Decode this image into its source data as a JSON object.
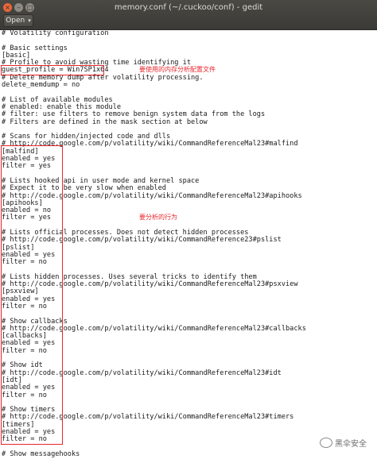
{
  "window": {
    "title": "memory.conf (~/.cuckoo/conf) - gedit",
    "close_glyph": "×",
    "min_glyph": "–",
    "max_glyph": "□"
  },
  "toolbar": {
    "open_label": "Open",
    "open_caret": "▾"
  },
  "editor": {
    "lines": [
      "# Volatility configuration",
      "",
      "# Basic settings",
      "[basic]",
      "# Profile to avoid wasting time identifying it",
      "guest_profile = Win7SP1x64",
      "# Delete memory dump after volatility processing.",
      "delete_memdump = no",
      "",
      "# List of available modules",
      "# enabled: enable this module",
      "# filter: use filters to remove benign system data from the logs",
      "# Filters are defined in the mask section at below",
      "",
      "# Scans for hidden/injected code and dlls",
      "# http://code.google.com/p/volatility/wiki/CommandReferenceMal23#malfind",
      "[malfind]",
      "enabled = yes",
      "filter = yes",
      "",
      "# Lists hooked api in user mode and kernel space",
      "# Expect it to be very slow when enabled",
      "# http://code.google.com/p/volatility/wiki/CommandReferenceMal23#apihooks",
      "[apihooks]",
      "enabled = no",
      "filter = yes",
      "",
      "# Lists official processes. Does not detect hidden processes",
      "# http://code.google.com/p/volatility/wiki/CommandReference23#pslist",
      "[pslist]",
      "enabled = yes",
      "filter = no",
      "",
      "# Lists hidden processes. Uses several tricks to identify them",
      "# http://code.google.com/p/volatility/wiki/CommandReferenceMal23#psxview",
      "[psxview]",
      "enabled = yes",
      "filter = no",
      "",
      "# Show callbacks",
      "# http://code.google.com/p/volatility/wiki/CommandReferenceMal23#callbacks",
      "[callbacks]",
      "enabled = yes",
      "filter = no",
      "",
      "# Show idt",
      "# http://code.google.com/p/volatility/wiki/CommandReferenceMal23#idt",
      "[idt]",
      "enabled = yes",
      "filter = no",
      "",
      "# Show timers",
      "# http://code.google.com/p/volatility/wiki/CommandReferenceMal23#timers",
      "[timers]",
      "enabled = yes",
      "filter = no",
      "",
      "# Show messagehooks"
    ]
  },
  "annotations": {
    "profile_note": "要使用的内存分析配置文件",
    "behavior_note": "要分析的行为",
    "color": "#e8262d"
  },
  "watermark": {
    "text": "黑伞安全"
  }
}
